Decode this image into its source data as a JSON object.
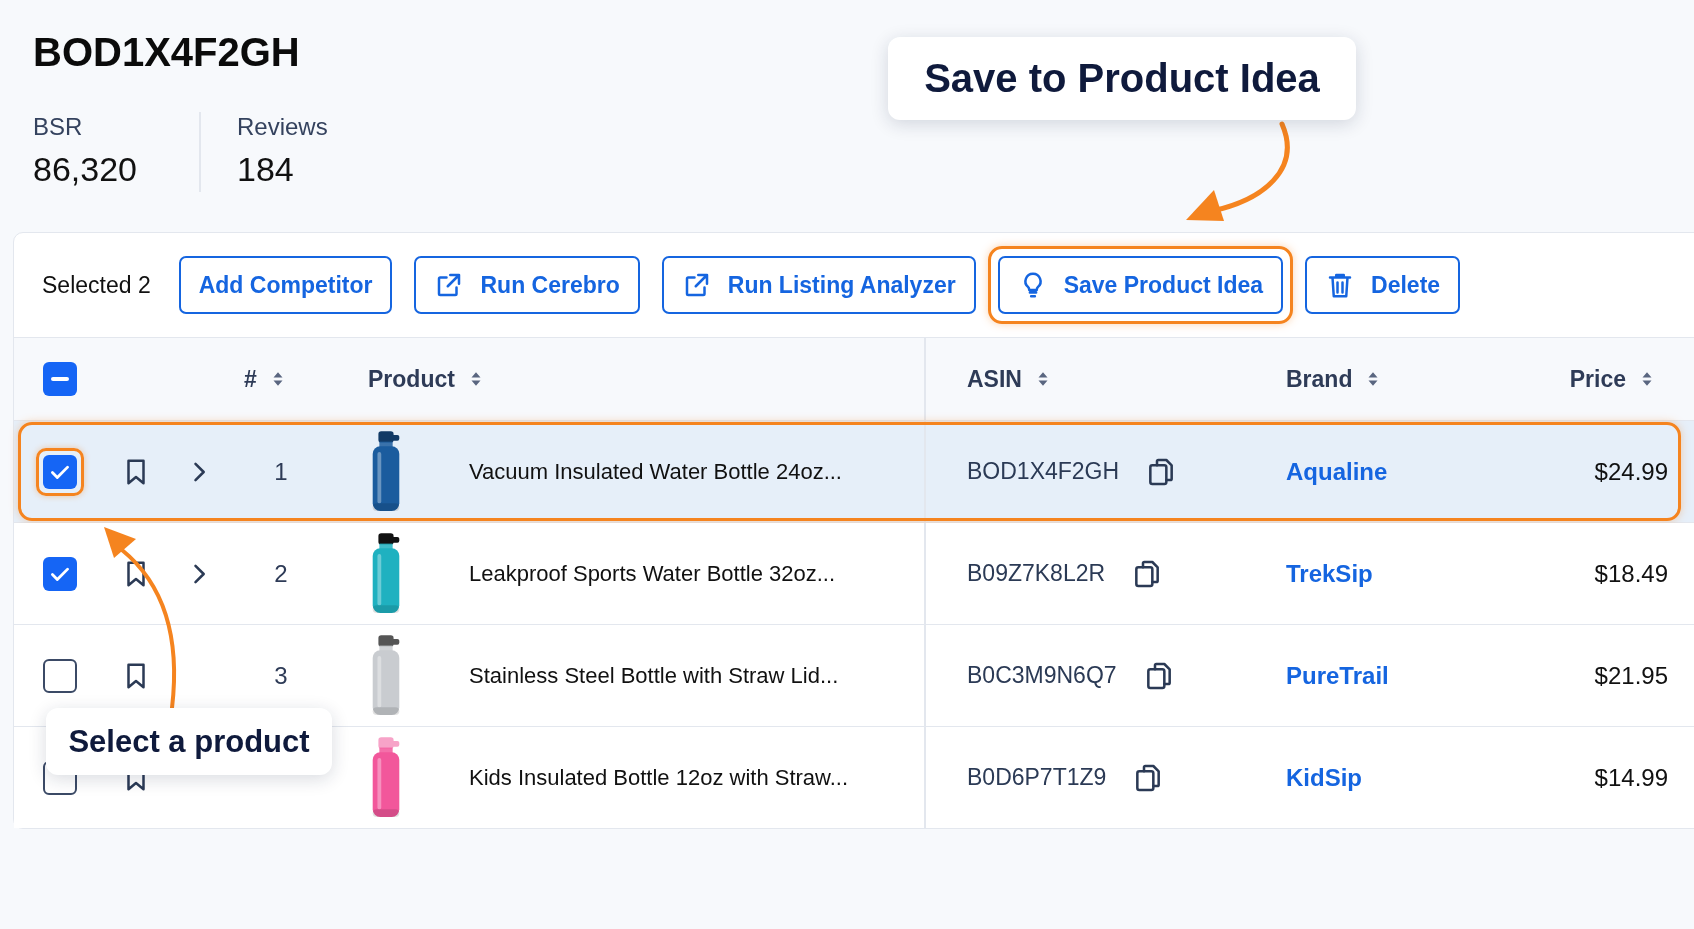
{
  "product": {
    "title": "BOD1X4F2GH",
    "stats": [
      {
        "label": "BSR",
        "value": "86,320"
      },
      {
        "label": "Reviews",
        "value": "184"
      }
    ]
  },
  "toolbar": {
    "selection": "Selected 2",
    "actions": [
      {
        "label": "Add Competitor",
        "kind": "plain",
        "highlighted": false
      },
      {
        "label": "Run Cerebro",
        "kind": "external",
        "highlighted": false
      },
      {
        "label": "Run Listing Analyzer",
        "kind": "external",
        "highlighted": false
      },
      {
        "label": "Save Product Idea",
        "kind": "idea",
        "highlighted": true
      },
      {
        "label": "Delete",
        "kind": "trash",
        "highlighted": false
      }
    ]
  },
  "table": {
    "select_all_partial": true,
    "columns": [
      {
        "label": "#"
      },
      {
        "label": "Product"
      },
      {
        "label": "ASIN"
      },
      {
        "label": "Brand"
      },
      {
        "label": "Price"
      }
    ],
    "rows": [
      {
        "selected": true,
        "highlighted": true,
        "checked": true,
        "expandable": true,
        "number": "1",
        "product": "Vacuum Insulated Water Bottle 24oz...",
        "asin": "BOD1X4F2GH",
        "brand": "Aqualine",
        "price": "$24.99"
      },
      {
        "selected": false,
        "highlighted": false,
        "checked": true,
        "expandable": true,
        "number": "2",
        "product": "Leakproof Sports Water Bottle 32oz...",
        "asin": "B09Z7K8L2R",
        "brand": "TrekSip",
        "price": "$18.49"
      },
      {
        "selected": false,
        "highlighted": false,
        "checked": false,
        "expandable": false,
        "number": "3",
        "product": "Stainless Steel Bottle with Straw Lid...",
        "asin": "B0C3M9N6Q7",
        "brand": "PureTrail",
        "price": "$21.95"
      },
      {
        "selected": false,
        "highlighted": false,
        "checked": false,
        "expandable": false,
        "product": "Kids Insulated Bottle 12oz with Straw...",
        "asin": "B0D6P7T1Z9",
        "brand": "KidSip",
        "price": "$14.99"
      }
    ]
  },
  "callouts": [
    {
      "text": "Save to Product Idea"
    },
    {
      "text": "Select a product"
    }
  ]
}
